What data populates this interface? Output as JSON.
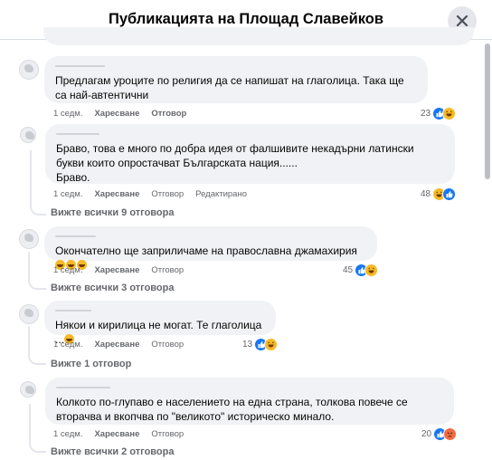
{
  "header": {
    "title": "Публикацията на Площад Славейков"
  },
  "comments": [
    {
      "text": "Предлагам уроците по религия да се напишат на глаголица. Така ще са най-автентични",
      "time": "1 седм.",
      "like": "Харесване",
      "reply": "Отговор",
      "reactions": {
        "count": "23",
        "icons": [
          "like-icon",
          "haha-icon"
        ]
      }
    },
    {
      "text": "Браво, това е много по добра идея от фалшивите некадърни латински букви които опростачват Българската нация......\nБраво.",
      "time": "1 седм.",
      "like": "Харесване",
      "reply": "Отговор",
      "edited": "Редактирано",
      "reactions": {
        "count": "48",
        "icons": [
          "haha-icon",
          "like-icon"
        ]
      },
      "view_replies": "Вижте всички 9 отговора"
    },
    {
      "text": "Окончателно ще заприличаме на православна джамахирия",
      "time": "1 седм.",
      "like": "Харесване",
      "reply": "Отговор",
      "reactions": {
        "count": "45",
        "icons": [
          "like-icon",
          "haha-icon"
        ]
      },
      "view_replies": "Вижте всички 3 отговора"
    },
    {
      "text": "Някои и кирилица не могат. Те глаголица ...",
      "time": "1 седм.",
      "like": "Харесване",
      "reply": "Отговор",
      "reactions": {
        "count": "13",
        "icons": [
          "like-icon",
          "haha-icon"
        ]
      },
      "view_replies": "Вижте 1 отговор"
    },
    {
      "text": "Колкото по-глупаво е населението на една страна, толкова повече се вторачва и вкопчва по \"великото\" историческо минало.",
      "time": "1 седм.",
      "like": "Харесване",
      "reply": "Отговор",
      "reactions": {
        "count": "20",
        "icons": [
          "like-icon",
          "angry-icon"
        ]
      },
      "view_replies": "Вижте всички 2 отговора"
    }
  ],
  "colors": {
    "bubble": "#f0f2f5",
    "like": "#1877f2",
    "haha": "#f7b928",
    "angry": "#f06b45",
    "muted": "#65676b"
  }
}
